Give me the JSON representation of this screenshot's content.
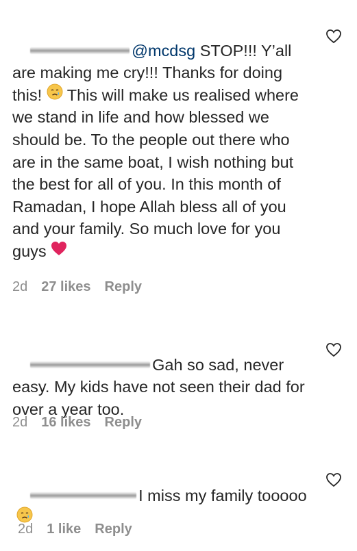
{
  "comments": [
    {
      "mention": "@mcdsg",
      "text_before_emoji": " STOP!!! Y’all are making me cry!!! Thanks for doing this! ",
      "emoji": "crying-face",
      "text_after_emoji": " This will make us realised where we stand in life and how blessed we should be. To the people out there who are in the same boat, I wish nothing but the best for all of you. In this month of Ramadan, I hope Allah bless all of you and your family. So much love for you guys ",
      "trailing_emoji": "red-heart",
      "time": "2d",
      "likes": "27 likes",
      "reply": "Reply"
    },
    {
      "text": "Gah so sad, never easy. My kids have not seen their dad for over a year too.",
      "time": "2d",
      "likes": "16 likes",
      "reply": "Reply"
    },
    {
      "text": "I miss my family tooooo",
      "emoji": "crying-face",
      "time": "2d",
      "likes": "1 like",
      "reply": "Reply"
    }
  ],
  "colors": {
    "text": "#262626",
    "secondary": "#8e8e8e",
    "mention": "#00376b",
    "heart_emoji": "#e0245e"
  }
}
